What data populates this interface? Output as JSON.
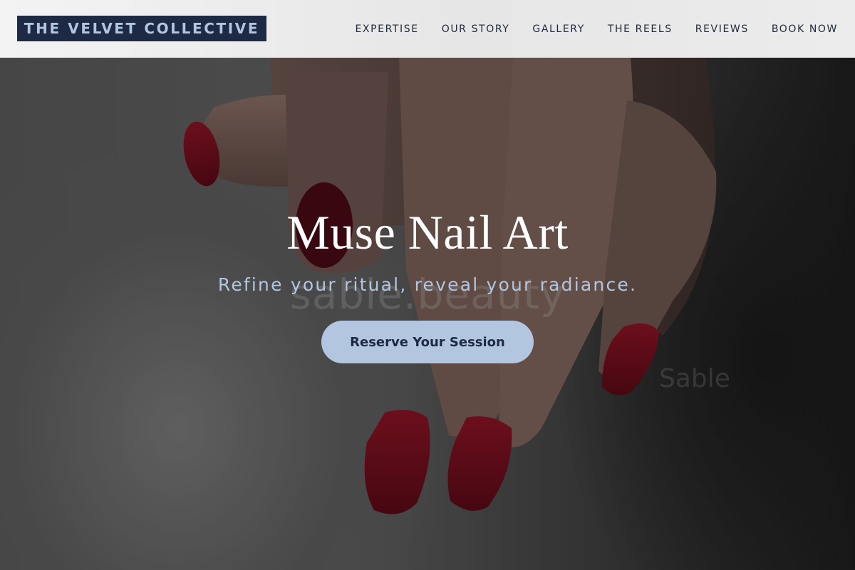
{
  "brand": {
    "name": "THE VELVET COLLECTIVE"
  },
  "nav": {
    "items": [
      {
        "label": "EXPERTISE"
      },
      {
        "label": "OUR STORY"
      },
      {
        "label": "GALLERY"
      },
      {
        "label": "THE REELS"
      },
      {
        "label": "REVIEWS"
      },
      {
        "label": "BOOK NOW"
      }
    ]
  },
  "hero": {
    "title": "Muse Nail Art",
    "subtitle": "Refine your ritual, reveal your radiance.",
    "cta_label": "Reserve Your Session",
    "watermark": "sable.beauty",
    "watermark_small": "Sable"
  },
  "colors": {
    "brand_navy": "#1e2a44",
    "accent_blue": "#b3c6e0",
    "nail_red": "#7a0f1e"
  }
}
